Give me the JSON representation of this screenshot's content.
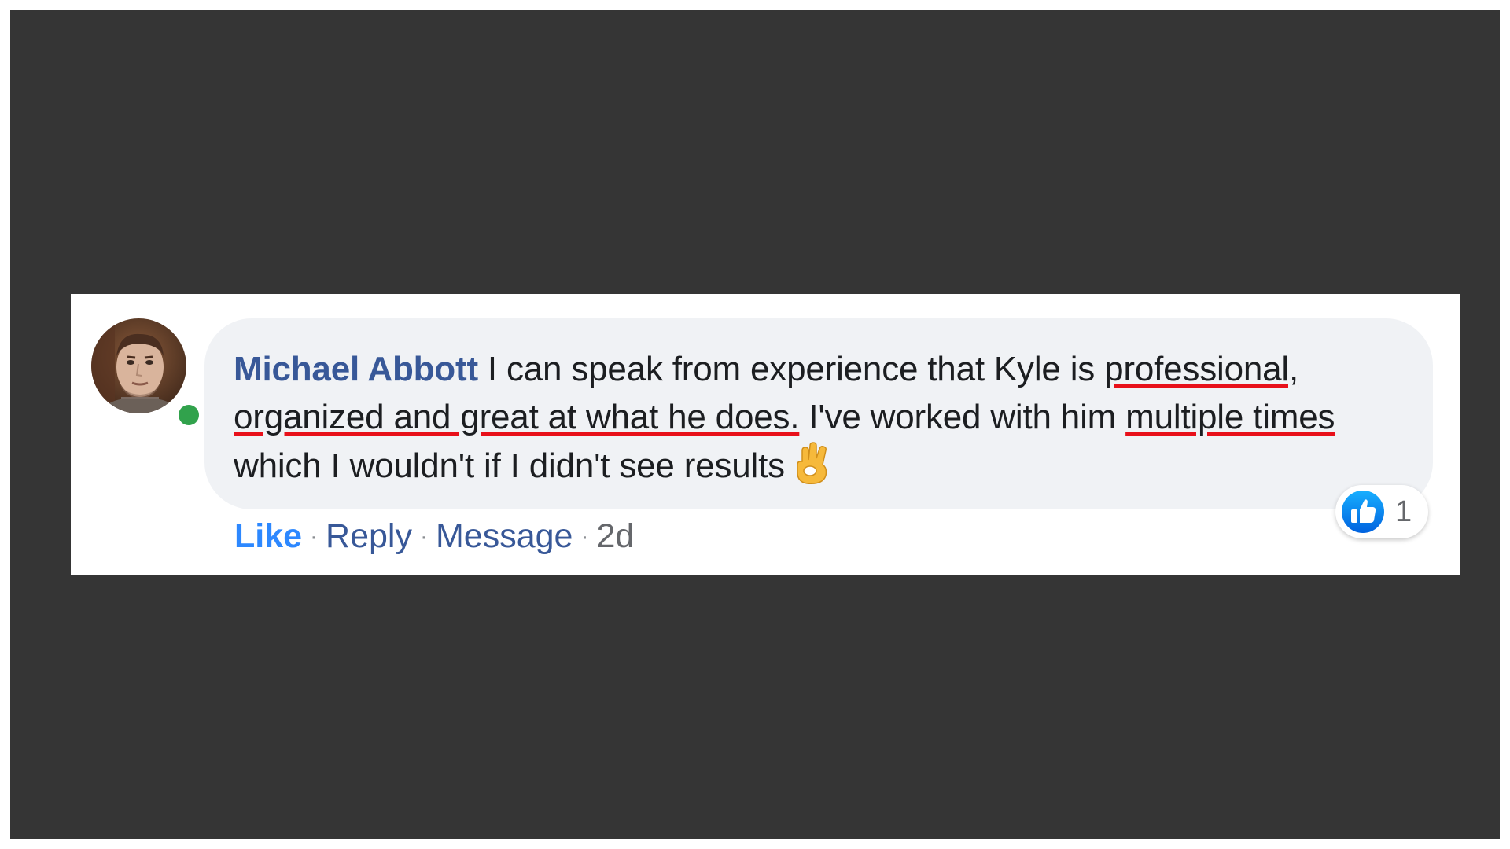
{
  "comment": {
    "author": "Michael Abbott",
    "text_parts": {
      "p1": " I can speak from experience that Kyle is ",
      "h1": "professional, organized and great at what he does.",
      "p2": " I've worked with him ",
      "h2": "multiple times",
      "p3": " which I wouldn't if I didn't see results"
    },
    "emoji": "ok-hand-icon",
    "reactions": {
      "type": "like",
      "count": "1"
    },
    "actions": {
      "like": "Like",
      "reply": "Reply",
      "message": "Message",
      "time": "2d",
      "separator": "·"
    }
  },
  "colors": {
    "background_frame": "#353535",
    "card": "#ffffff",
    "bubble": "#f0f2f5",
    "author_link": "#385898",
    "like_action": "#2d88ff",
    "highlight_underline": "#e8101a",
    "presence_online": "#31a24c",
    "like_reaction": "#1877f2"
  }
}
